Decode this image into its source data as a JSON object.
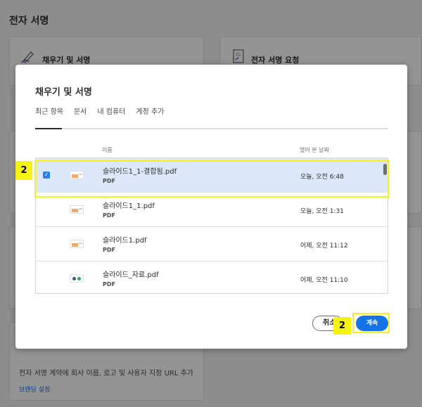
{
  "page": {
    "title": "전자 서명",
    "cards": [
      {
        "label": "채우기 및 서명",
        "icon": "pen-sign-icon"
      },
      {
        "label": "전자 서명 요청",
        "icon": "request-signature-icon"
      }
    ],
    "footer_text": "전자 서명 계약에 회사 이름, 로고 및 사용자 지정 URL 추가",
    "footer_link": "브랜딩 설정"
  },
  "dialog": {
    "title": "채우기 및 서명",
    "tabs": [
      {
        "label": "최근 항목",
        "active": true
      },
      {
        "label": "문서",
        "active": false
      },
      {
        "label": "내 컴퓨터",
        "active": false
      },
      {
        "label": "계정 추가",
        "active": false
      }
    ],
    "columns": {
      "name": "이름",
      "date": "열어 본 날짜"
    },
    "files": [
      {
        "name": "슬라이드1_1-결합됨.pdf",
        "type": "PDF",
        "date": "오늘, 오전 6:48",
        "selected": true
      },
      {
        "name": "슬라이드1_1.pdf",
        "type": "PDF",
        "date": "오늘, 오전 1:31",
        "selected": false
      },
      {
        "name": "슬라이드1.pdf",
        "type": "PDF",
        "date": "어제, 오전 11:12",
        "selected": false
      },
      {
        "name": "슬라이드_자료.pdf",
        "type": "PDF",
        "date": "어제, 오전 11:10",
        "selected": false
      }
    ],
    "buttons": {
      "cancel": "취소",
      "continue": "계속"
    }
  },
  "annotations": {
    "row_badge": "2",
    "button_badge": "2"
  },
  "colors": {
    "accent": "#1473e6",
    "highlight": "#f7f216",
    "selected_row": "#dce8f9"
  }
}
